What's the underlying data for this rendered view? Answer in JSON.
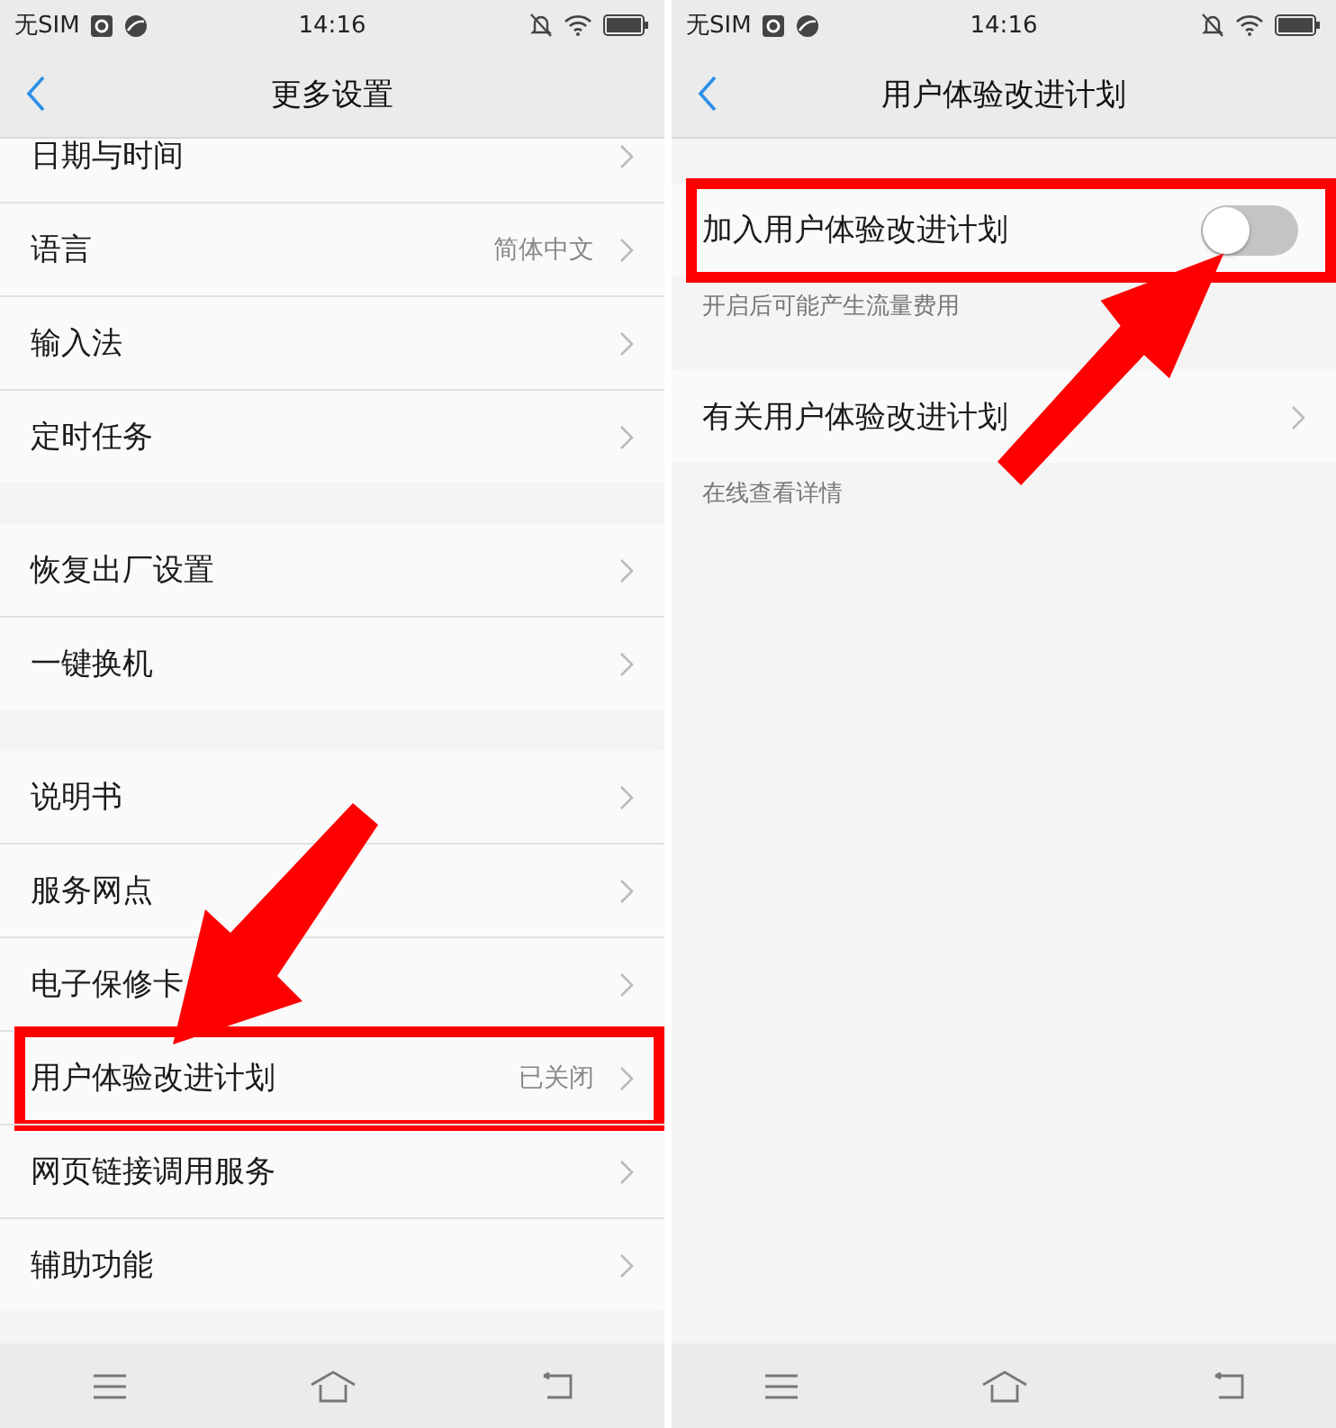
{
  "screens": [
    {
      "status_bar": {
        "carrier": "无SIM",
        "time": "14:16"
      },
      "title": "更多设置",
      "pointer": {
        "kind": "down-left"
      },
      "groups": [
        {
          "items": [
            {
              "kind": "link",
              "label": "日期与时间",
              "cut_off": true,
              "highlighted": false
            },
            {
              "kind": "link",
              "label": "语言",
              "value": "简体中文",
              "highlighted": false
            },
            {
              "kind": "link",
              "label": "输入法",
              "highlighted": false
            },
            {
              "kind": "link",
              "label": "定时任务",
              "highlighted": false
            }
          ]
        },
        {
          "items": [
            {
              "kind": "link",
              "label": "恢复出厂设置",
              "highlighted": false
            },
            {
              "kind": "link",
              "label": "一键换机",
              "highlighted": false
            }
          ]
        },
        {
          "items": [
            {
              "kind": "link",
              "label": "说明书",
              "highlighted": false
            },
            {
              "kind": "link",
              "label": "服务网点",
              "highlighted": false
            },
            {
              "kind": "link",
              "label": "电子保修卡",
              "highlighted": false
            },
            {
              "kind": "link",
              "label": "用户体验改进计划",
              "value": "已关闭",
              "highlighted": true
            },
            {
              "kind": "link",
              "label": "网页链接调用服务",
              "highlighted": false
            },
            {
              "kind": "link",
              "label": "辅助功能",
              "highlighted": false
            }
          ]
        }
      ]
    },
    {
      "status_bar": {
        "carrier": "无SIM",
        "time": "14:16"
      },
      "title": "用户体验改进计划",
      "pointer": {
        "kind": "up-right"
      },
      "groups": [
        {
          "items": [
            {
              "kind": "toggle",
              "label": "加入用户体验改进计划",
              "on": false,
              "highlighted": true
            }
          ],
          "note": "开启后可能产生流量费用"
        },
        {
          "items": [
            {
              "kind": "link",
              "label": "有关用户体验改进计划",
              "highlighted": false
            }
          ],
          "note": "在线查看详情"
        }
      ]
    }
  ]
}
